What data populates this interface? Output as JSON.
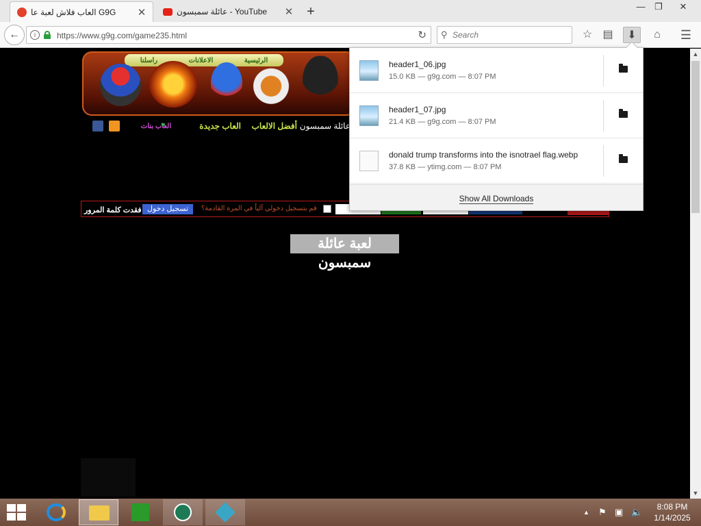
{
  "browser": {
    "tabs": [
      {
        "title": "العاب فلاش لعبة عا G9G",
        "active": true,
        "favicon_color": "#e2412c"
      },
      {
        "title": "عائلة سمبسون - YouTube",
        "active": false,
        "favicon_color": "#e62117"
      }
    ],
    "new_tab": "+",
    "window_controls": {
      "minimize": "—",
      "restore": "❐",
      "close": "✕"
    },
    "url": "https://www.g9g.com/game235.html",
    "search_placeholder": "Search",
    "toolbar_icons": [
      "bookmark-star-icon",
      "reading-list-icon",
      "downloads-icon",
      "home-icon",
      "menu-icon"
    ]
  },
  "site": {
    "banner_menu": [
      "الرئيسية",
      "الاعلانات",
      "راسلنا"
    ],
    "nav": {
      "game_name": "عائلة سمبسون",
      "best_games": "أفضل الالعاب",
      "new_games": "العاب جديدة",
      "girls_games": "العاب بنات"
    },
    "login": {
      "forgot_password": "فقدت كلمة المرور",
      "login_button": "تسجيل دخول",
      "remember_me": "قم بتسجيل دخولي آلياً في المرة القادمة؟"
    },
    "game_title": "لعبة عائلة سمبسون"
  },
  "downloads": {
    "items": [
      {
        "name": "header1_06.jpg",
        "meta": "15.0 KB — g9g.com — 8:07 PM",
        "type": "image"
      },
      {
        "name": "header1_07.jpg",
        "meta": "21.4 KB — g9g.com — 8:07 PM",
        "type": "image"
      },
      {
        "name": "donald trump transforms into the isnotrael flag.webp",
        "meta": "37.8 KB — ytimg.com — 8:07 PM",
        "type": "document"
      }
    ],
    "show_all": "Show All Downloads"
  },
  "taskbar": {
    "apps": [
      "internet-explorer-icon",
      "file-explorer-icon",
      "store-icon",
      "app-circle-icon",
      "app-cube-icon"
    ],
    "clock_time": "8:08 PM",
    "clock_date": "1/14/2025"
  }
}
